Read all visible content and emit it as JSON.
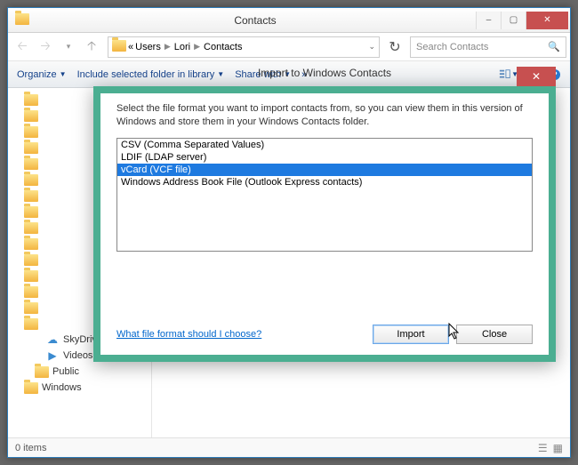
{
  "window": {
    "title": "Contacts",
    "min_label": "–",
    "max_label": "▢",
    "close_label": "✕"
  },
  "nav": {
    "breadcrumb_prefix": "«",
    "crumbs": [
      "Users",
      "Lori",
      "Contacts"
    ],
    "search_placeholder": "Search Contacts"
  },
  "toolbar": {
    "organize": "Organize",
    "include": "Include selected folder in library",
    "share": "Share with",
    "overflow": "»"
  },
  "tree": {
    "items": [
      {
        "label": "",
        "depth": 0,
        "kind": "folder"
      },
      {
        "label": "",
        "depth": 0,
        "kind": "folder"
      },
      {
        "label": "",
        "depth": 0,
        "kind": "folder"
      },
      {
        "label": "",
        "depth": 0,
        "kind": "folder"
      },
      {
        "label": "",
        "depth": 0,
        "kind": "folder"
      },
      {
        "label": "",
        "depth": 0,
        "kind": "folder"
      },
      {
        "label": "",
        "depth": 0,
        "kind": "folder"
      },
      {
        "label": "",
        "depth": 0,
        "kind": "folder"
      },
      {
        "label": "",
        "depth": 0,
        "kind": "folder"
      },
      {
        "label": "",
        "depth": 0,
        "kind": "folder"
      },
      {
        "label": "",
        "depth": 0,
        "kind": "folder"
      },
      {
        "label": "",
        "depth": 0,
        "kind": "folder"
      },
      {
        "label": "",
        "depth": 0,
        "kind": "folder"
      },
      {
        "label": "",
        "depth": 0,
        "kind": "folder"
      },
      {
        "label": "",
        "depth": 0,
        "kind": "folder"
      },
      {
        "label": "SkyDrive",
        "depth": 2,
        "kind": "skydrive"
      },
      {
        "label": "Videos",
        "depth": 2,
        "kind": "videos"
      },
      {
        "label": "Public",
        "depth": 1,
        "kind": "folder"
      },
      {
        "label": "Windows",
        "depth": 0,
        "kind": "folder"
      }
    ]
  },
  "status": {
    "text": "0 items"
  },
  "dialog": {
    "title": "Import to Windows Contacts",
    "description": "Select the file format you want to import contacts from, so you can view them in this version of Windows and store them in your Windows Contacts folder.",
    "options": [
      "CSV (Comma Separated Values)",
      "LDIF (LDAP server)",
      "vCard (VCF file)",
      "Windows Address Book File (Outlook Express contacts)"
    ],
    "selected_index": 2,
    "help_link": "What file format should I choose?",
    "import_label": "Import",
    "close_label": "Close",
    "x_label": "✕"
  }
}
